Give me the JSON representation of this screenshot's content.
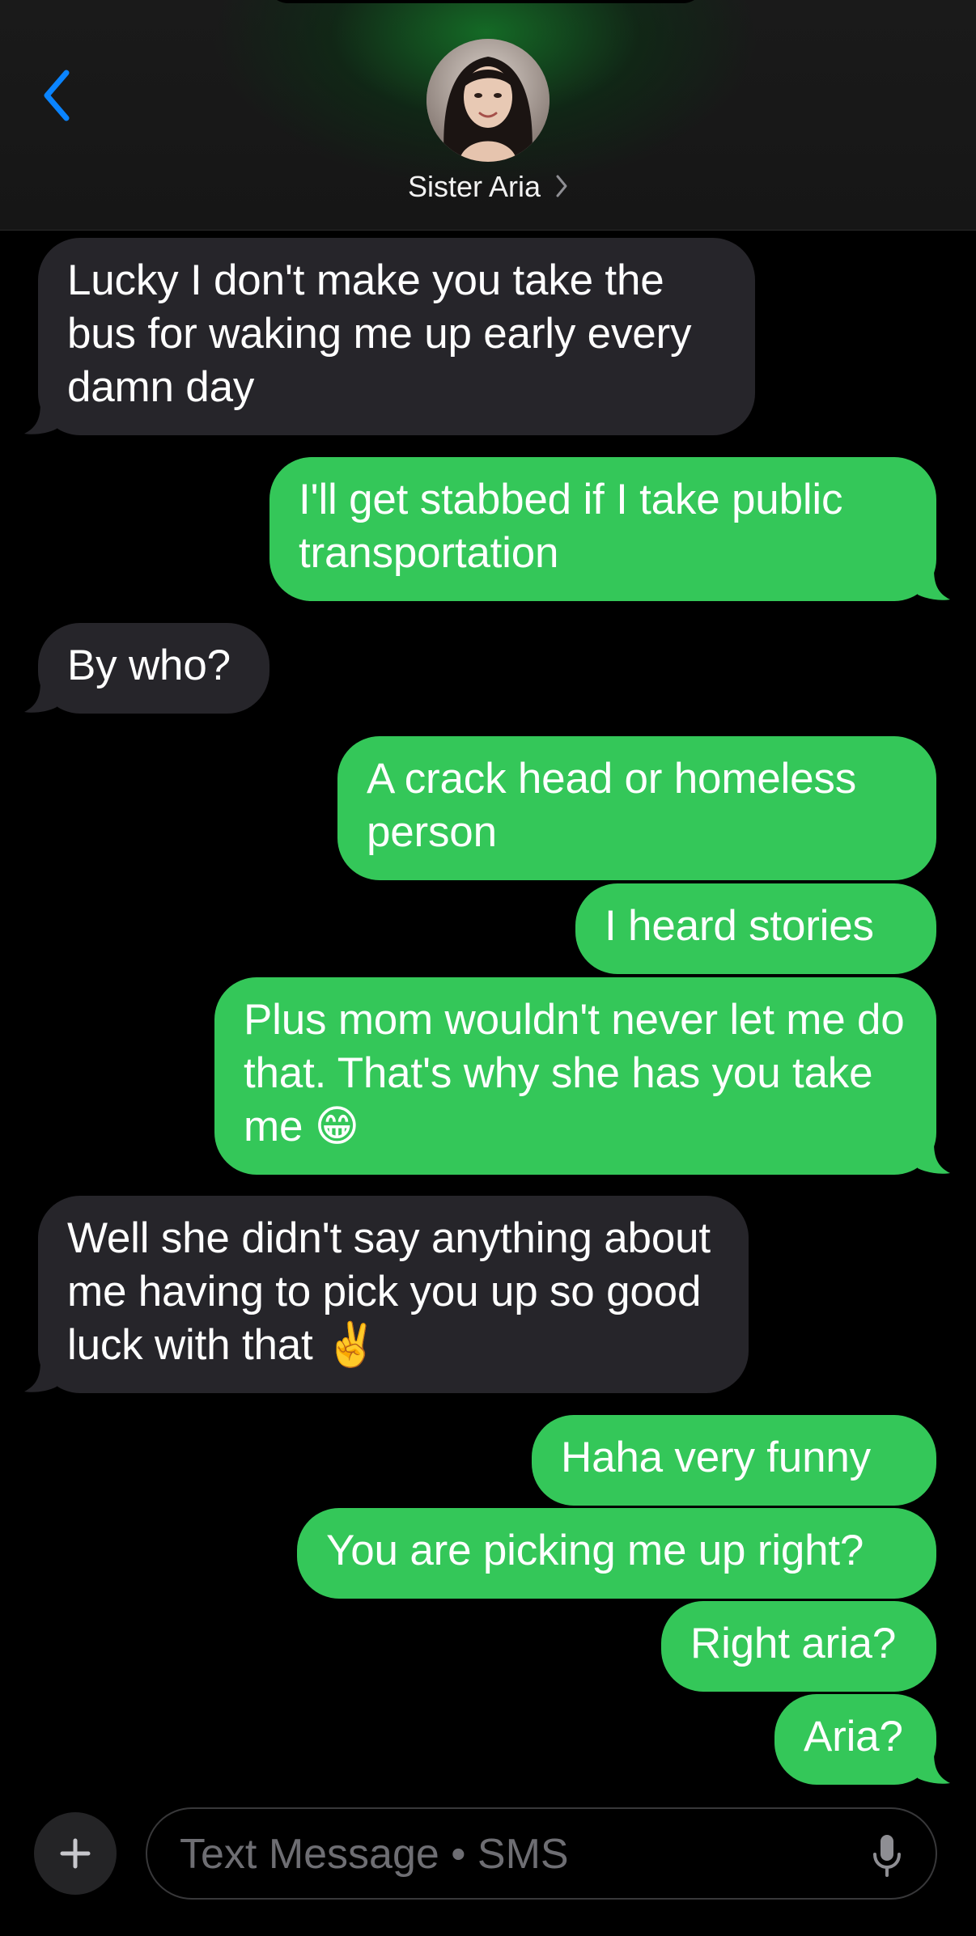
{
  "header": {
    "contact_name": "Sister Aria",
    "back_icon": "chevron-left-icon",
    "accent_color": "#0a84ff"
  },
  "messages": [
    {
      "direction": "incoming",
      "text": "Lucky I don't make you take the bus for waking me up early every damn day"
    },
    {
      "direction": "outgoing",
      "text": "I'll get stabbed if I take public transportation"
    },
    {
      "direction": "incoming",
      "text": "By who?"
    },
    {
      "direction": "outgoing",
      "text": "A crack head or homeless person"
    },
    {
      "direction": "outgoing",
      "text": "I heard stories"
    },
    {
      "direction": "outgoing",
      "text": "Plus mom wouldn't never let me do that. That's why she has you take me 😁"
    },
    {
      "direction": "incoming",
      "text": "Well she didn't say anything about me having to pick you up so good luck with that ✌️"
    },
    {
      "direction": "outgoing",
      "text": "Haha very funny"
    },
    {
      "direction": "outgoing",
      "text": "You are picking me up right?"
    },
    {
      "direction": "outgoing",
      "text": "Right aria?"
    },
    {
      "direction": "outgoing",
      "text": "Aria?"
    }
  ],
  "composer": {
    "placeholder": "Text Message • SMS",
    "value": "",
    "plus_icon": "plus-icon",
    "mic_icon": "microphone-icon"
  },
  "colors": {
    "outgoing_bubble": "#34c759",
    "incoming_bubble": "#26252a",
    "background": "#000000"
  }
}
